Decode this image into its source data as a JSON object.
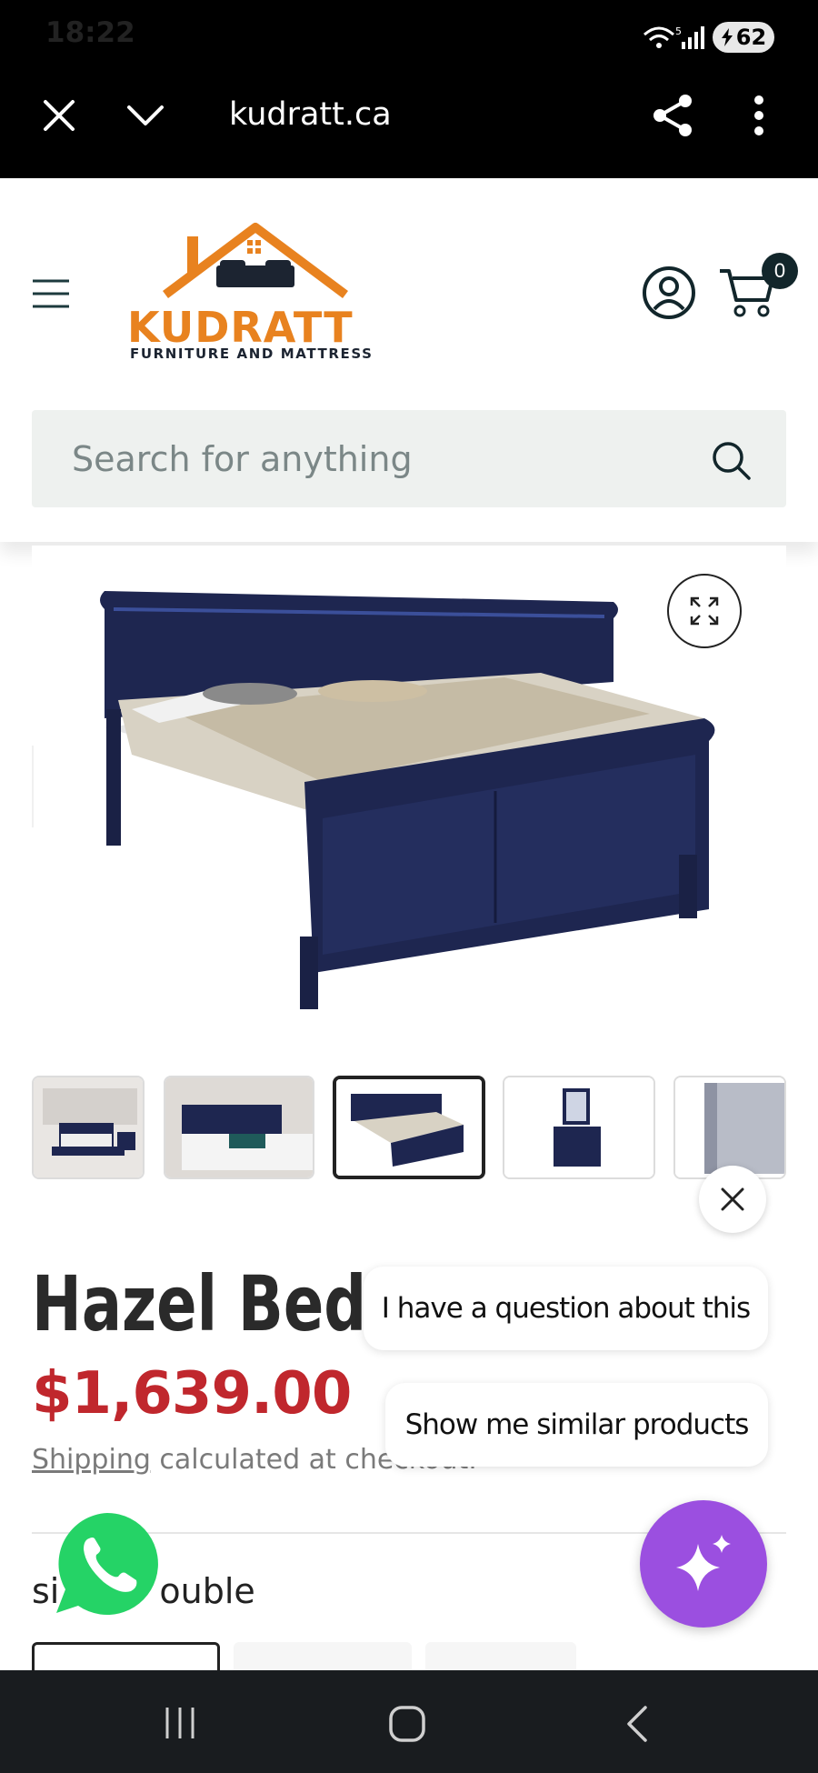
{
  "status_bar": {
    "time": "18:22",
    "battery": "62"
  },
  "browser": {
    "url": "kudratt.ca"
  },
  "site": {
    "logo_text": "KUDRATT",
    "logo_tagline": "FURNITURE AND MATTRESS",
    "cart_count": "0",
    "search_placeholder": "Search for anything"
  },
  "gallery": {
    "thumbnail_count": 5,
    "active_thumbnail": 3
  },
  "chat": {
    "suggestion_1": "I have a question about this",
    "suggestion_2": "Show me similar products"
  },
  "product": {
    "title": "Hazel Bedr",
    "price": "$1,639.00",
    "shipping_link": "Shipping",
    "shipping_rest": " calculated at checkout.",
    "size_label": "si",
    "size_value": "ouble"
  },
  "colors": {
    "brand_orange": "#e8821f",
    "price_red": "#c0272d",
    "ai_purple": "#9b4fe0",
    "whatsapp_green": "#25d366"
  }
}
